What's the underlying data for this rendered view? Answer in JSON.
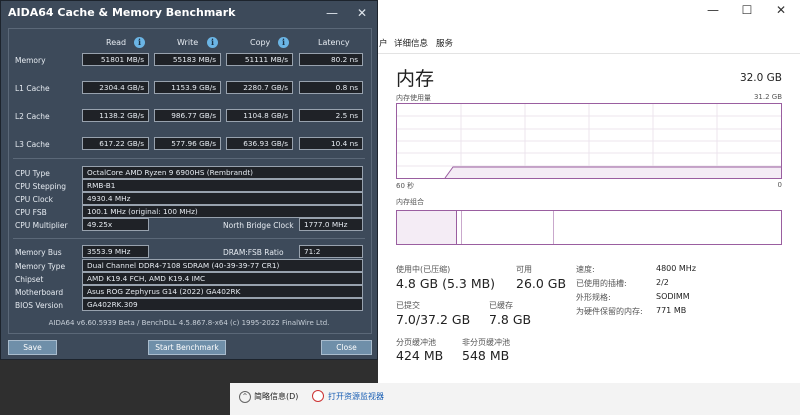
{
  "aida": {
    "title": "AIDA64 Cache & Memory Benchmark",
    "columns": {
      "read": "Read",
      "write": "Write",
      "copy": "Copy",
      "latency": "Latency"
    },
    "rows": [
      {
        "label": "Memory",
        "read": "51801 MB/s",
        "write": "55183 MB/s",
        "copy": "51111 MB/s",
        "latency": "80.2 ns"
      },
      {
        "label": "L1 Cache",
        "read": "2304.4 GB/s",
        "write": "1153.9 GB/s",
        "copy": "2280.7 GB/s",
        "latency": "0.8 ns"
      },
      {
        "label": "L2 Cache",
        "read": "1138.2 GB/s",
        "write": "986.77 GB/s",
        "copy": "1104.8 GB/s",
        "latency": "2.5 ns"
      },
      {
        "label": "L3 Cache",
        "read": "617.22 GB/s",
        "write": "577.96 GB/s",
        "copy": "636.93 GB/s",
        "latency": "10.4 ns"
      }
    ],
    "cpu": {
      "type_label": "CPU Type",
      "type": "OctalCore AMD Ryzen 9 6900HS  (Rembrandt)",
      "stepping_label": "CPU Stepping",
      "stepping": "RMB-B1",
      "clock_label": "CPU Clock",
      "clock": "4930.4 MHz",
      "fsb_label": "CPU FSB",
      "fsb": "100.1 MHz  (original: 100 MHz)",
      "multiplier_label": "CPU Multiplier",
      "multiplier": "49.25x",
      "nb_clock_label": "North Bridge Clock",
      "nb_clock": "1777.0 MHz"
    },
    "system": {
      "bus_label": "Memory Bus",
      "bus": "3553.9 MHz",
      "ratio_label": "DRAM:FSB Ratio",
      "ratio": "71:2",
      "memtype_label": "Memory Type",
      "memtype": "Dual Channel DDR4-7108 SDRAM  (40-39-39-77 CR1)",
      "chipset_label": "Chipset",
      "chipset": "AMD K19.4 FCH, AMD K19.4 IMC",
      "mobo_label": "Motherboard",
      "mobo": "Asus ROG Zephyrus G14 (2022) GA402RK",
      "bios_label": "BIOS Version",
      "bios": "GA402RK.309"
    },
    "footer": "AIDA64 v6.60.5939 Beta / BenchDLL 4.5.867.8-x64  (c) 1995-2022 FinalWire Ltd.",
    "buttons": {
      "save": "Save",
      "start": "Start Benchmark",
      "close": "Close"
    }
  },
  "taskmgr": {
    "tabs": [
      "户",
      "详细信息",
      "服务"
    ],
    "title": "内存",
    "total": "32.0 GB",
    "usage_label": "内存使用量",
    "usage_max": "31.2 GB",
    "axis_left": "60 秒",
    "axis_right": "0",
    "composition_label": "内存组合",
    "stats": {
      "in_use_label": "使用中(已压缩)",
      "in_use": "4.8 GB (5.3 MB)",
      "available_label": "可用",
      "available": "26.0 GB",
      "committed_label": "已提交",
      "committed": "7.0/37.2 GB",
      "cached_label": "已缓存",
      "cached": "7.8 GB",
      "paged_label": "分页缓冲池",
      "paged": "424 MB",
      "nonpaged_label": "非分页缓冲池",
      "nonpaged": "548 MB"
    },
    "specs": {
      "speed_label": "速度:",
      "speed": "4800 MHz",
      "slots_label": "已使用的插槽:",
      "slots": "2/2",
      "form_label": "外形规格:",
      "form": "SODIMM",
      "reserved_label": "为硬件保留的内存:",
      "reserved": "771 MB"
    },
    "bottom": {
      "brief": "简略信息(D)",
      "resmon": "打开资源监视器"
    },
    "colors": {
      "accent": "#9a5ea0",
      "fill": "#f4ecf5"
    }
  }
}
